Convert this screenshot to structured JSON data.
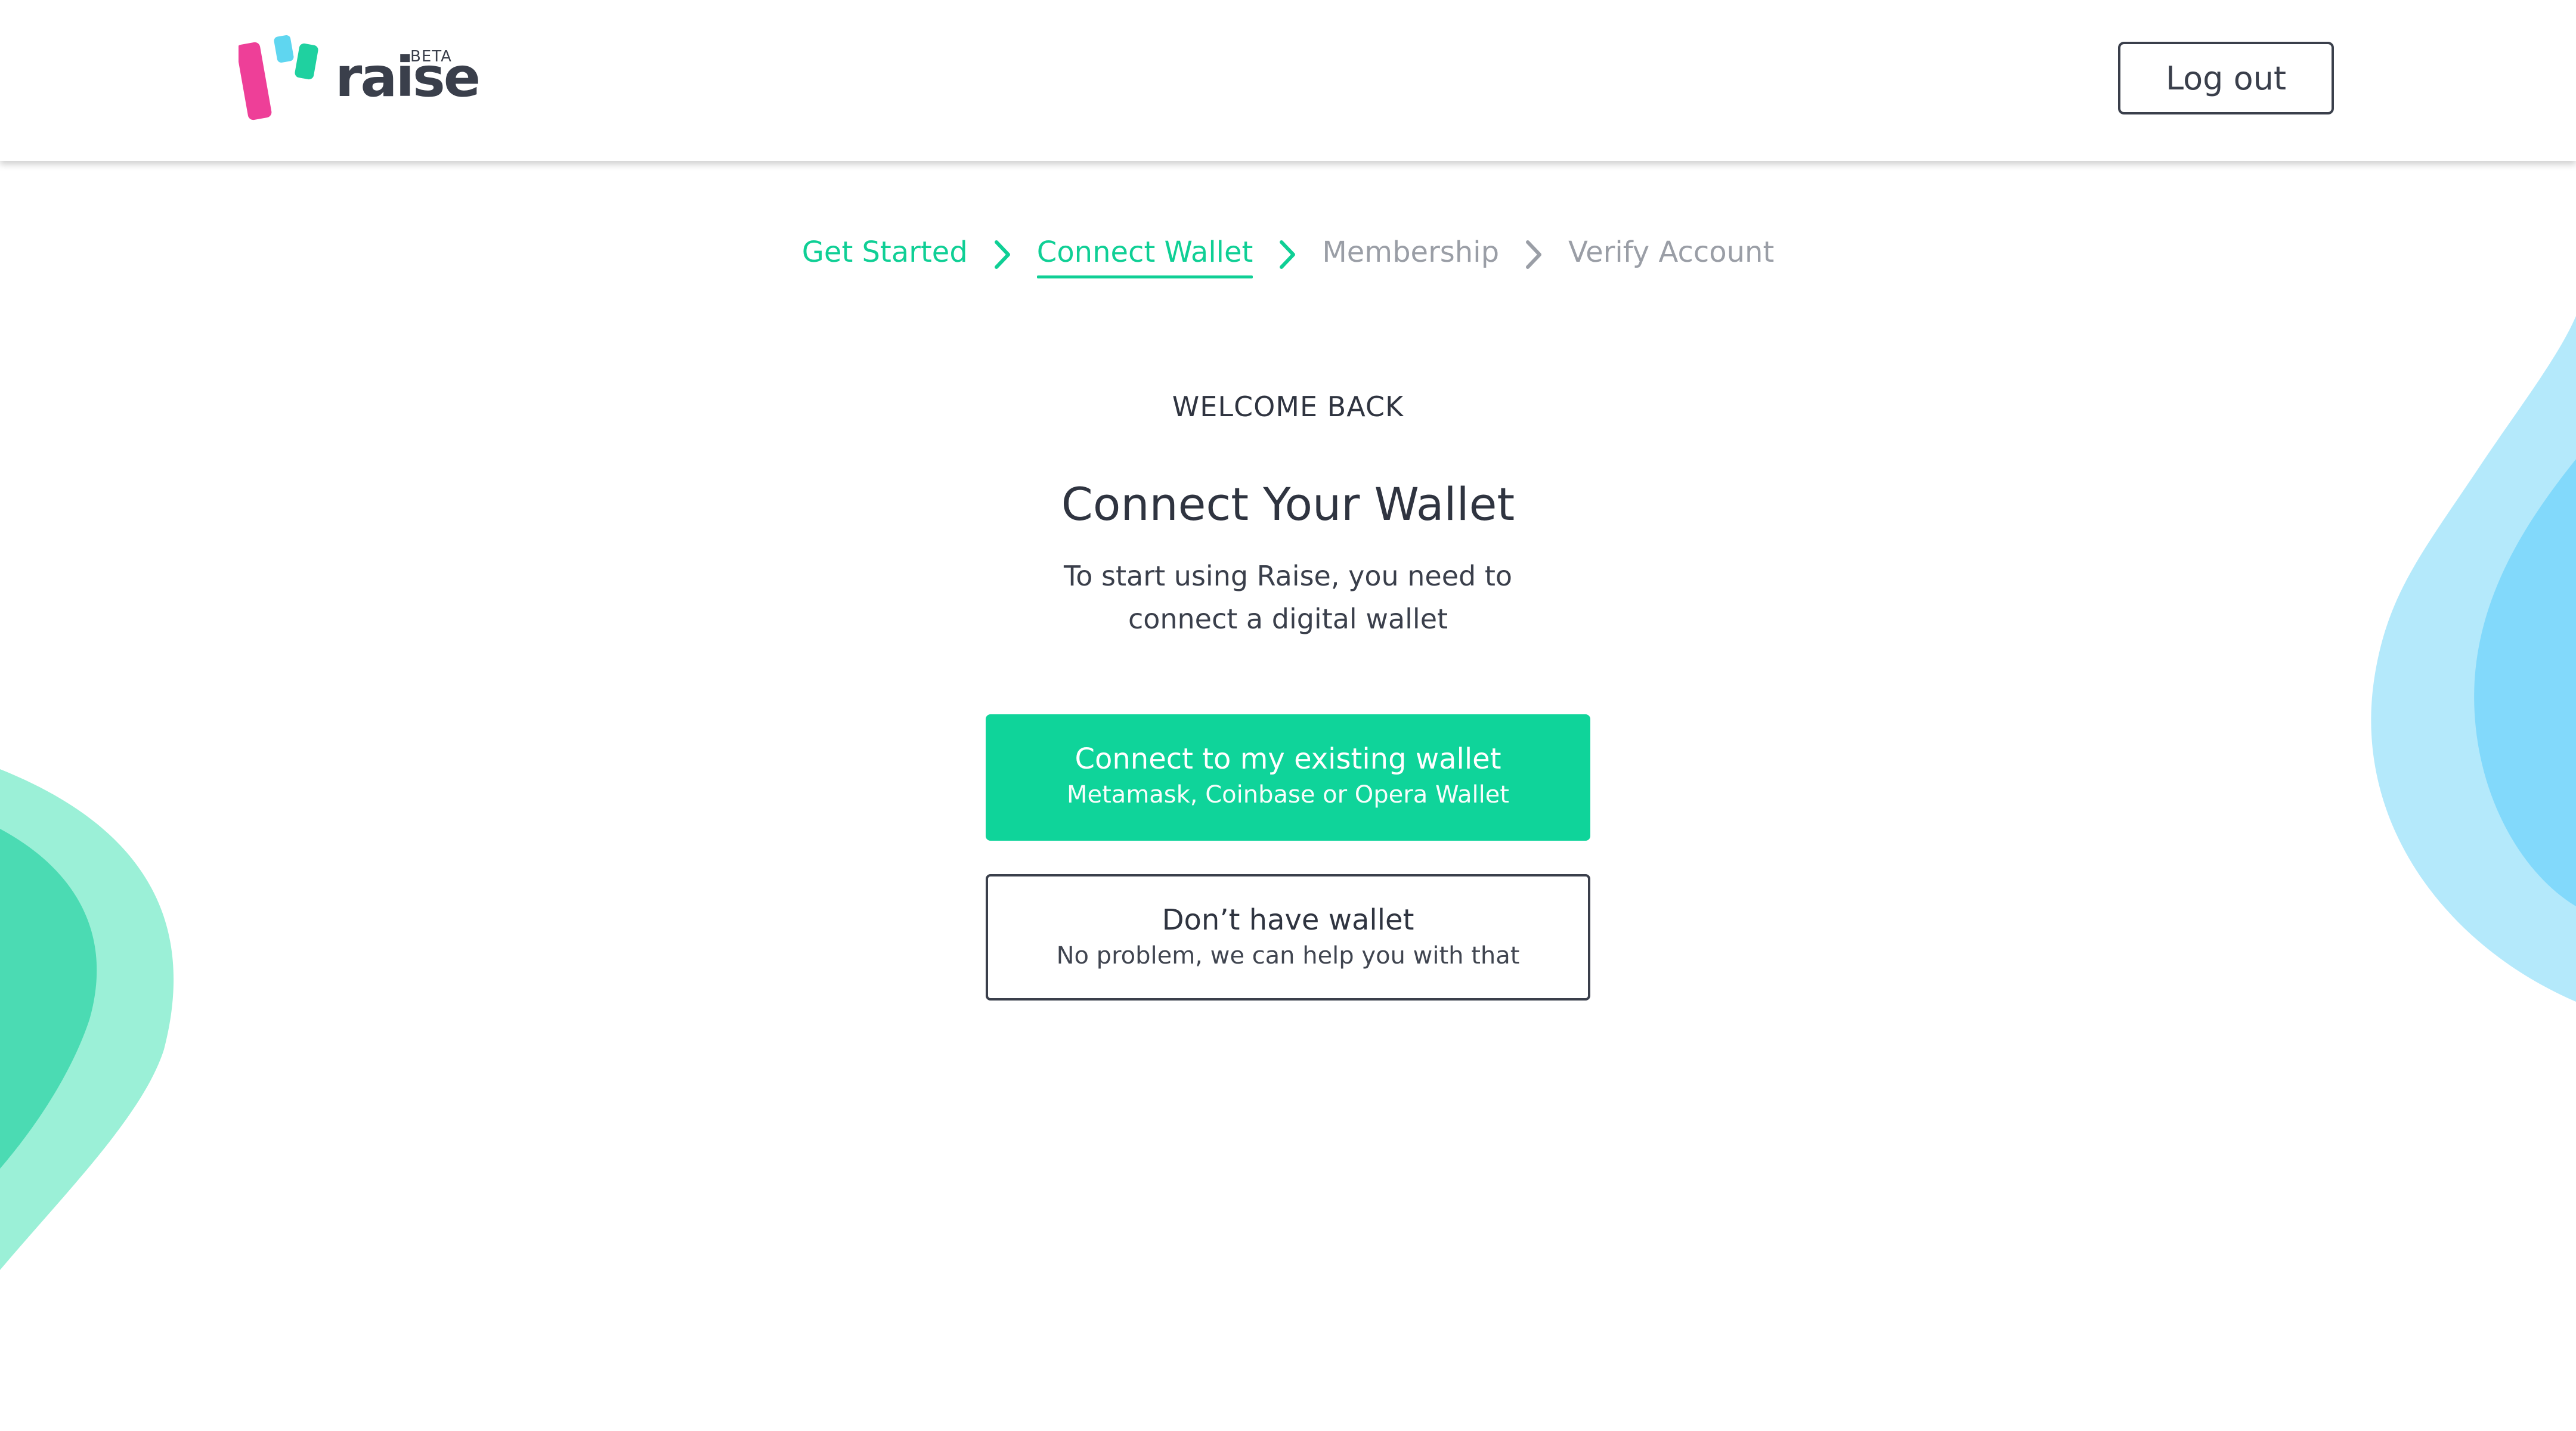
{
  "app": {
    "brand": "raise",
    "beta_badge": "BETA"
  },
  "header": {
    "logout_label": "Log out"
  },
  "stepper": {
    "steps": [
      {
        "label": "Get Started",
        "state": "done"
      },
      {
        "label": "Connect Wallet",
        "state": "active"
      },
      {
        "label": "Membership",
        "state": "upcoming"
      },
      {
        "label": "Verify Account",
        "state": "upcoming"
      }
    ]
  },
  "main": {
    "eyebrow": "WELCOME BACK",
    "title": "Connect Your Wallet",
    "subtitle_line1": "To start using Raise, you need to",
    "subtitle_line2": "connect a digital wallet",
    "primary_button": {
      "title": "Connect to my existing wallet",
      "subtitle": "Metamask, Coinbase or Opera Wallet"
    },
    "secondary_button": {
      "title": "Don’t have wallet",
      "subtitle": "No problem, we can help you with that"
    }
  },
  "colors": {
    "accent_green": "#0fd49a",
    "text_dark": "#3a3f4b",
    "inactive_step": "#9a9ea6",
    "logo_pink": "#ee3f98",
    "logo_cyan": "#5fd6f0",
    "logo_green": "#1fd1a0",
    "blob_blue_light": "#b4e9fb",
    "blob_blue": "#82d9fb",
    "blob_green_light": "#9bf0d7",
    "blob_green": "#4bdbb3"
  }
}
